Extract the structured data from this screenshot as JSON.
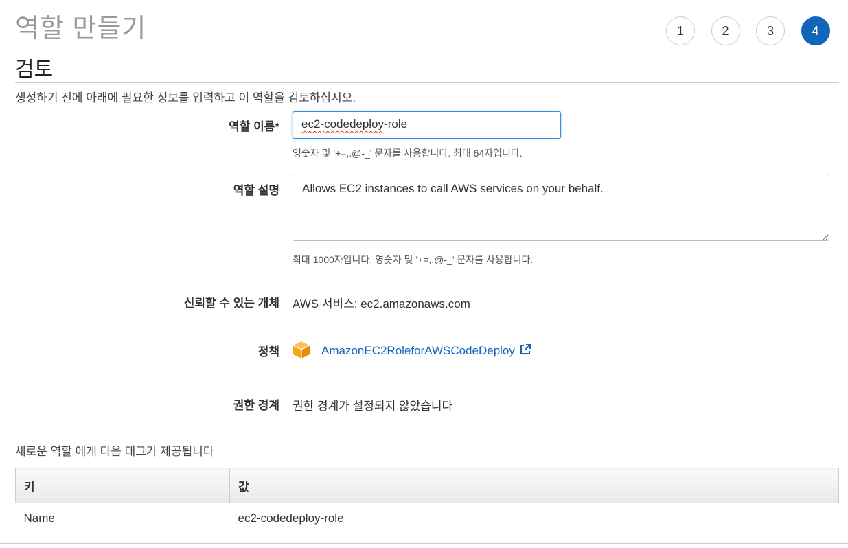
{
  "header": {
    "title": "역할 만들기",
    "steps": [
      "1",
      "2",
      "3",
      "4"
    ],
    "active_step": "4"
  },
  "section": {
    "title": "검토",
    "intro": "생성하기 전에 아래에 필요한 정보를 입력하고 이 역할을 검토하십시오."
  },
  "form": {
    "role_name": {
      "label": "역할 이름",
      "required_mark": "*",
      "value": "ec2-codedeploy-role",
      "value_parts": [
        "ec2-",
        "codedeploy",
        "-role"
      ],
      "hint": "영숫자 및 '+=,.@-_' 문자를 사용합니다. 최대 64자입니다."
    },
    "role_description": {
      "label": "역할 설명",
      "value": "Allows EC2 instances to call AWS services on your behalf.",
      "hint": "최대 1000자입니다. 영숫자 및 '+=,.@-_' 문자를 사용합니다."
    },
    "trusted_entity": {
      "label": "신뢰할 수 있는 개체",
      "value": "AWS 서비스: ec2.amazonaws.com"
    },
    "policy": {
      "label": "정책",
      "icon": "policy-cube-icon",
      "link_text": "AmazonEC2RoleforAWSCodeDeploy",
      "link_icon": "external-link-icon"
    },
    "permissions_boundary": {
      "label": "권한 경계",
      "value": "권한 경계가 설정되지 않았습니다"
    }
  },
  "tags": {
    "caption": "새로운 역할 에게 다음 태그가 제공됩니다",
    "headers": {
      "key": "키",
      "value": "값"
    },
    "rows": [
      {
        "key": "Name",
        "value": "ec2-codedeploy-role"
      }
    ]
  },
  "colors": {
    "accent": "#1166bb",
    "policy_icon": "#f7a31b",
    "title_gray": "#999999"
  }
}
